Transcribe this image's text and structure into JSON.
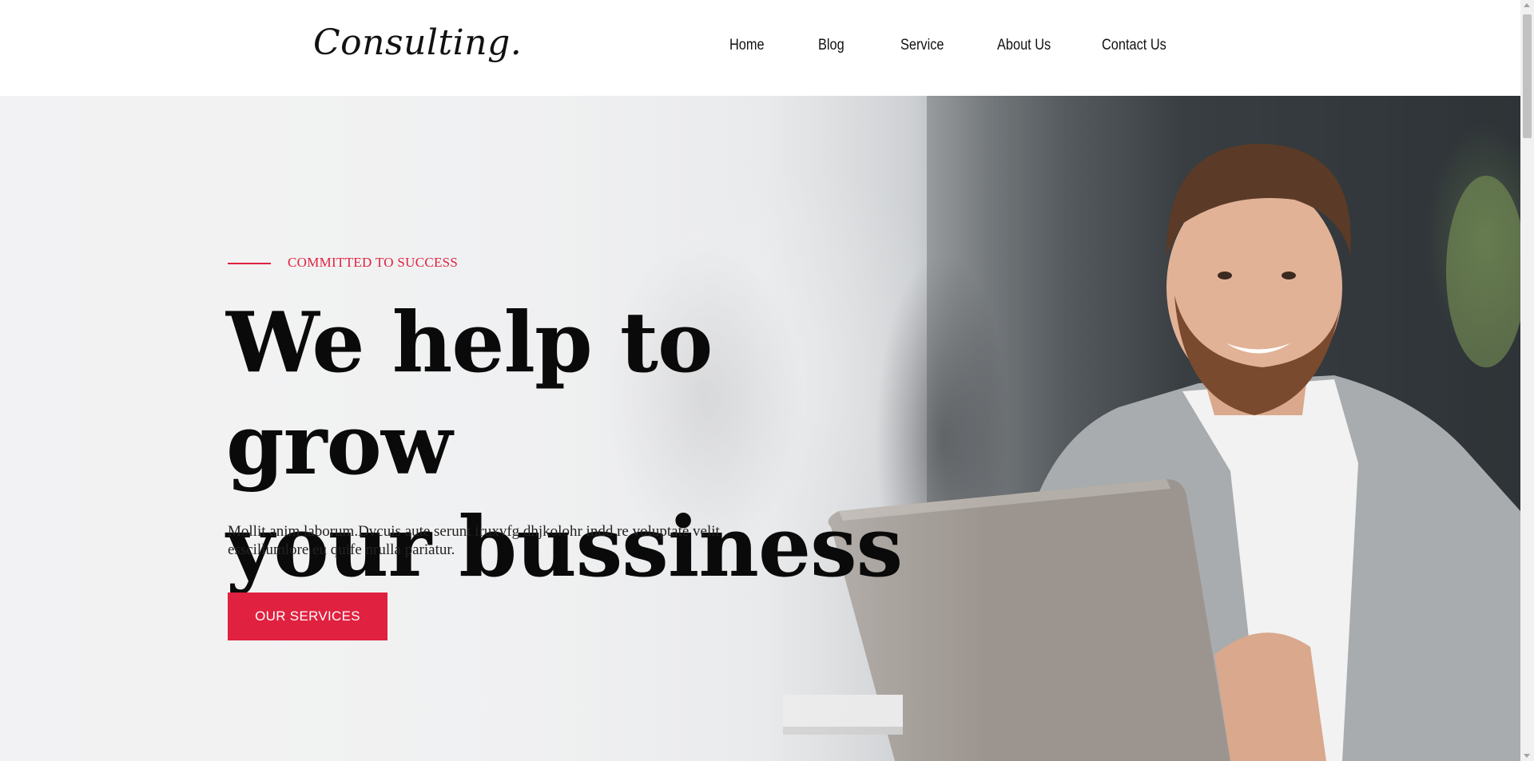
{
  "header": {
    "logo": "Consulting.",
    "nav": [
      {
        "label": "Home"
      },
      {
        "label": "Blog"
      },
      {
        "label": "Service"
      },
      {
        "label": "About Us"
      },
      {
        "label": "Contact Us"
      }
    ]
  },
  "hero": {
    "tagline": "COMMITTED TO SUCCESS",
    "headline_line1": "We help to grow",
    "headline_line2": "your bussiness",
    "description_line1": "Mollit anim laborum.Dvcuis aute serunt iruxvfg dhjkolohr indd re voluptate velit",
    "description_line2": "esscillumlore eu quife nrulla pariatur.",
    "cta_label": "OUR SERVICES",
    "accent_color": "#e0213f"
  }
}
